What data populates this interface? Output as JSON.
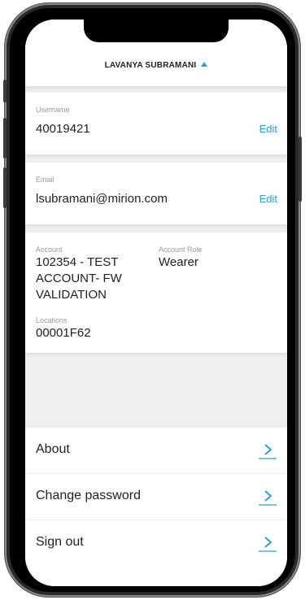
{
  "header": {
    "user_name": "LAVANYA SUBRAMANI"
  },
  "username": {
    "label": "Username",
    "value": "40019421",
    "edit_label": "Edit"
  },
  "email": {
    "label": "Email",
    "value": "lsubramani@mirion.com",
    "edit_label": "Edit"
  },
  "account": {
    "account_label": "Account",
    "account_lines": [
      "102354 - TEST",
      "ACCOUNT- FW",
      "VALIDATION"
    ],
    "role_label": "Account Role",
    "role_value": "Wearer",
    "locations_label": "Locations",
    "locations_value": "00001F62"
  },
  "menu": {
    "items": [
      {
        "label": "About"
      },
      {
        "label": "Change password"
      },
      {
        "label": "Sign out"
      }
    ]
  },
  "colors": {
    "accent": "#2a9fd6",
    "background": "#efefef"
  },
  "icons": {
    "header_toggle": "caret-up-icon",
    "menu_item": "chevron-right-icon"
  }
}
